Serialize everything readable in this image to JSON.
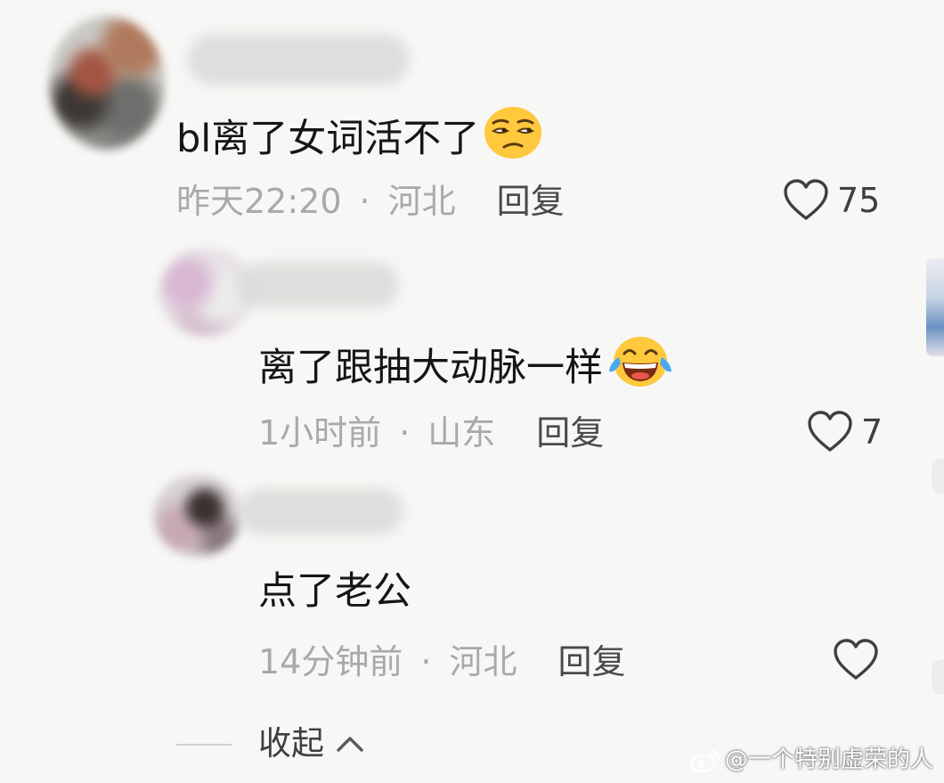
{
  "comments": [
    {
      "text": "bl离了女词活不了",
      "emoji": "unamused-face-emoji",
      "time": "昨天22:20",
      "location": "河北",
      "reply_label": "回复",
      "like_count": "75"
    },
    {
      "text": "离了跟抽大动脉一样",
      "emoji": "tears-of-joy-emoji",
      "time": "1小时前",
      "location": "山东",
      "reply_label": "回复",
      "like_count": "7"
    },
    {
      "text": "点了老公",
      "time": "14分钟前",
      "location": "河北",
      "reply_label": "回复",
      "like_count": ""
    }
  ],
  "separator": "·",
  "collapse_label": "收起",
  "watermark": "@一个特别虚荣的人",
  "icons": {
    "like": "heart-outline-icon",
    "collapse": "chevron-up-icon",
    "watermark": "weibo-logo-icon"
  },
  "colors": {
    "background": "#f7f7f5",
    "text": "#151515",
    "meta": "#a9a9a9",
    "emoji": "#ffc83d"
  }
}
